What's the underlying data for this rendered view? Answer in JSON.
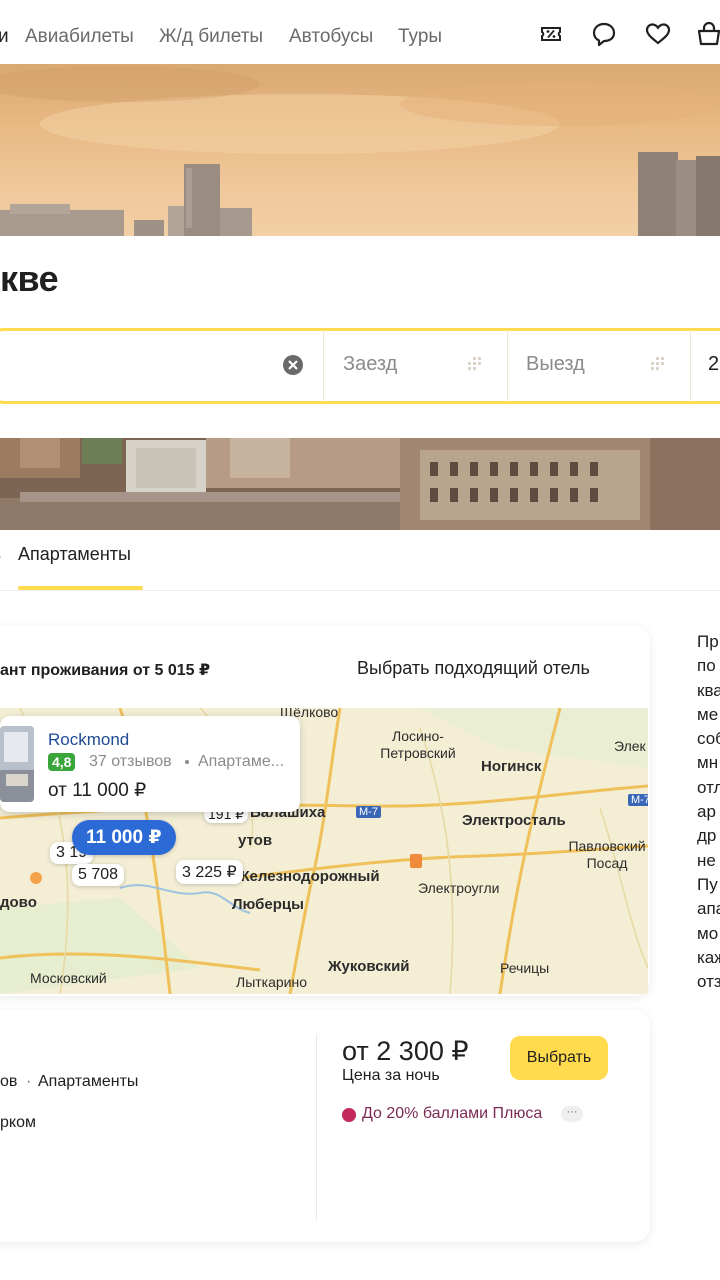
{
  "nav": {
    "items": [
      "и",
      "Авиабилеты",
      "Ж/д билеты",
      "Автобусы",
      "Туры"
    ],
    "icons": [
      "discount-icon",
      "chat-icon",
      "heart-icon",
      "cart-icon"
    ]
  },
  "page": {
    "title": "кве"
  },
  "search": {
    "checkin_placeholder": "Заезд",
    "checkout_placeholder": "Выезд",
    "guests_value": "2"
  },
  "tabs": {
    "active_label": "Апартаменты"
  },
  "map_card": {
    "min_price_label": "ант проживания от 5 015 ₽",
    "pick_hotel_link": "Выбрать подходящий отель",
    "places": [
      "Щёлково",
      "Лосино-Петровский",
      "Ногинск",
      "Элек",
      "Балашиха",
      "Электросталь",
      "Павловский Посад",
      "Железнодорожный",
      "Электроугли",
      "Люберцы",
      "Жуковский",
      "Московский",
      "Лыткарино",
      "Речицы",
      "утов",
      "дово"
    ],
    "highways": [
      "М-7",
      "М-7"
    ],
    "price_markers": [
      "11 000 ₽",
      "3 225 ₽",
      "3 19",
      "5 708",
      "191 ₽"
    ],
    "popup": {
      "hotel_name": "Rockmond",
      "rating": "4,8",
      "reviews": "37 отзывов",
      "type": "Апартаме...",
      "price": "от 11 000 ₽"
    }
  },
  "offer_card": {
    "meta_reviews": "ов",
    "meta_type": "Апартаменты",
    "meta_line2": "рком",
    "price": "от 2 300 ₽",
    "price_caption": "Цена за ночь",
    "select_button": "Выбрать",
    "plus_text": "До 20% баллами Плюса",
    "more_label": "···"
  },
  "side_text": [
    "Пр",
    "по",
    "ква",
    "ме",
    "соб",
    "мн",
    "отл",
    "ар",
    "др",
    "не",
    "Пу",
    "апа",
    "мо",
    "каж",
    "отз"
  ],
  "colors": {
    "accent": "#ffdb4d",
    "marker_active": "#2c6ad6",
    "rating_green": "#3aa53a",
    "link_blue": "#1f4a94",
    "plus": "#c4285d"
  }
}
